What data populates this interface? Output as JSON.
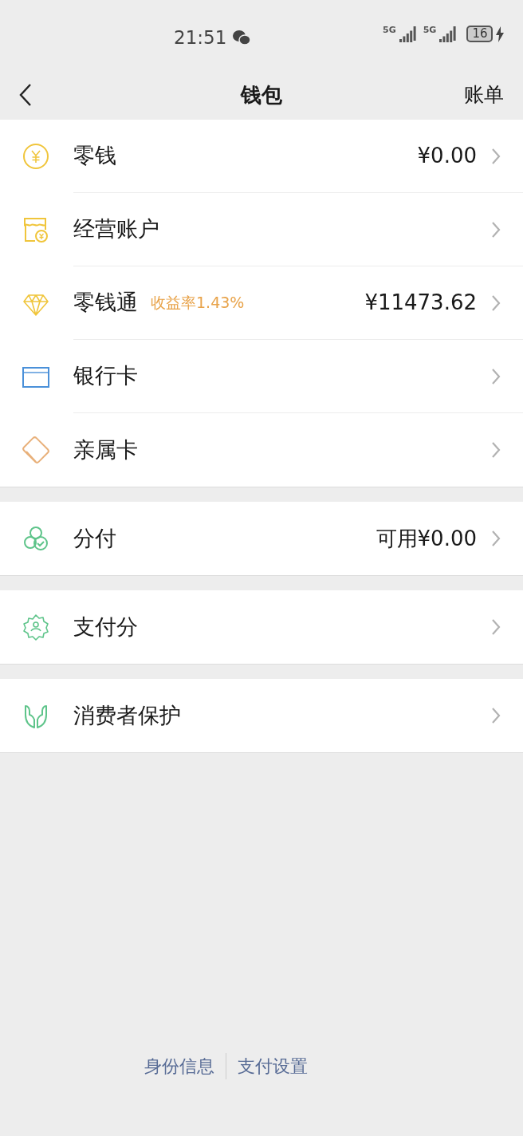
{
  "status_bar": {
    "time": "21:51",
    "network_1": "5G",
    "network_2": "5G",
    "battery": "16"
  },
  "nav": {
    "title": "钱包",
    "action": "账单"
  },
  "groups": [
    {
      "items": [
        {
          "label": "零钱",
          "value": "¥0.00"
        },
        {
          "label": "经营账户"
        },
        {
          "label": "零钱通",
          "tag": "收益率1.43%",
          "value": "¥11473.62"
        },
        {
          "label": "银行卡"
        },
        {
          "label": "亲属卡"
        }
      ]
    },
    {
      "items": [
        {
          "label": "分付",
          "value": "可用¥0.00"
        }
      ]
    },
    {
      "items": [
        {
          "label": "支付分"
        }
      ]
    },
    {
      "items": [
        {
          "label": "消费者保护"
        }
      ]
    }
  ],
  "footer_links": [
    "身份信息",
    "支付设置"
  ]
}
